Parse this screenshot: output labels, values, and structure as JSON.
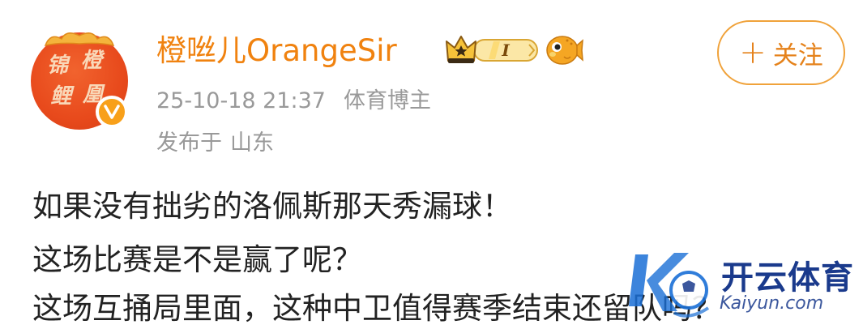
{
  "author": {
    "username": "橙咝儿OrangeSir",
    "level_badge": "I",
    "timestamp": "25-10-18 21:37",
    "role": "体育博主",
    "posted_from_label": "发布于",
    "location": "山东",
    "avatar_chars": [
      "橙",
      "锦",
      "鲤",
      "凰"
    ]
  },
  "follow_button": {
    "plus": "+",
    "label": "关注"
  },
  "post": {
    "lines": [
      "如果没有拙劣的洛佩斯那天秀漏球！",
      "这场比赛是不是赢了呢？",
      "这场互捅局里面，这种中卫值得赛季结束还留队吗？"
    ]
  },
  "watermark": {
    "brand": "开云体育",
    "domain": "Kaiyun.com"
  },
  "colors": {
    "username": "#f0820f",
    "meta": "#999999",
    "text": "#222222",
    "follow_border": "#f0a23a",
    "follow_text": "#e5821b",
    "avatar_bg": "#e84a1c",
    "verified": "#f8a01a",
    "watermark": "#1a3a8c"
  },
  "icons": {
    "verified": "verified-v-icon",
    "crown": "crown-icon",
    "pufferfish": "pufferfish-icon",
    "watermark_logo": "kaiyun-logo-icon"
  }
}
